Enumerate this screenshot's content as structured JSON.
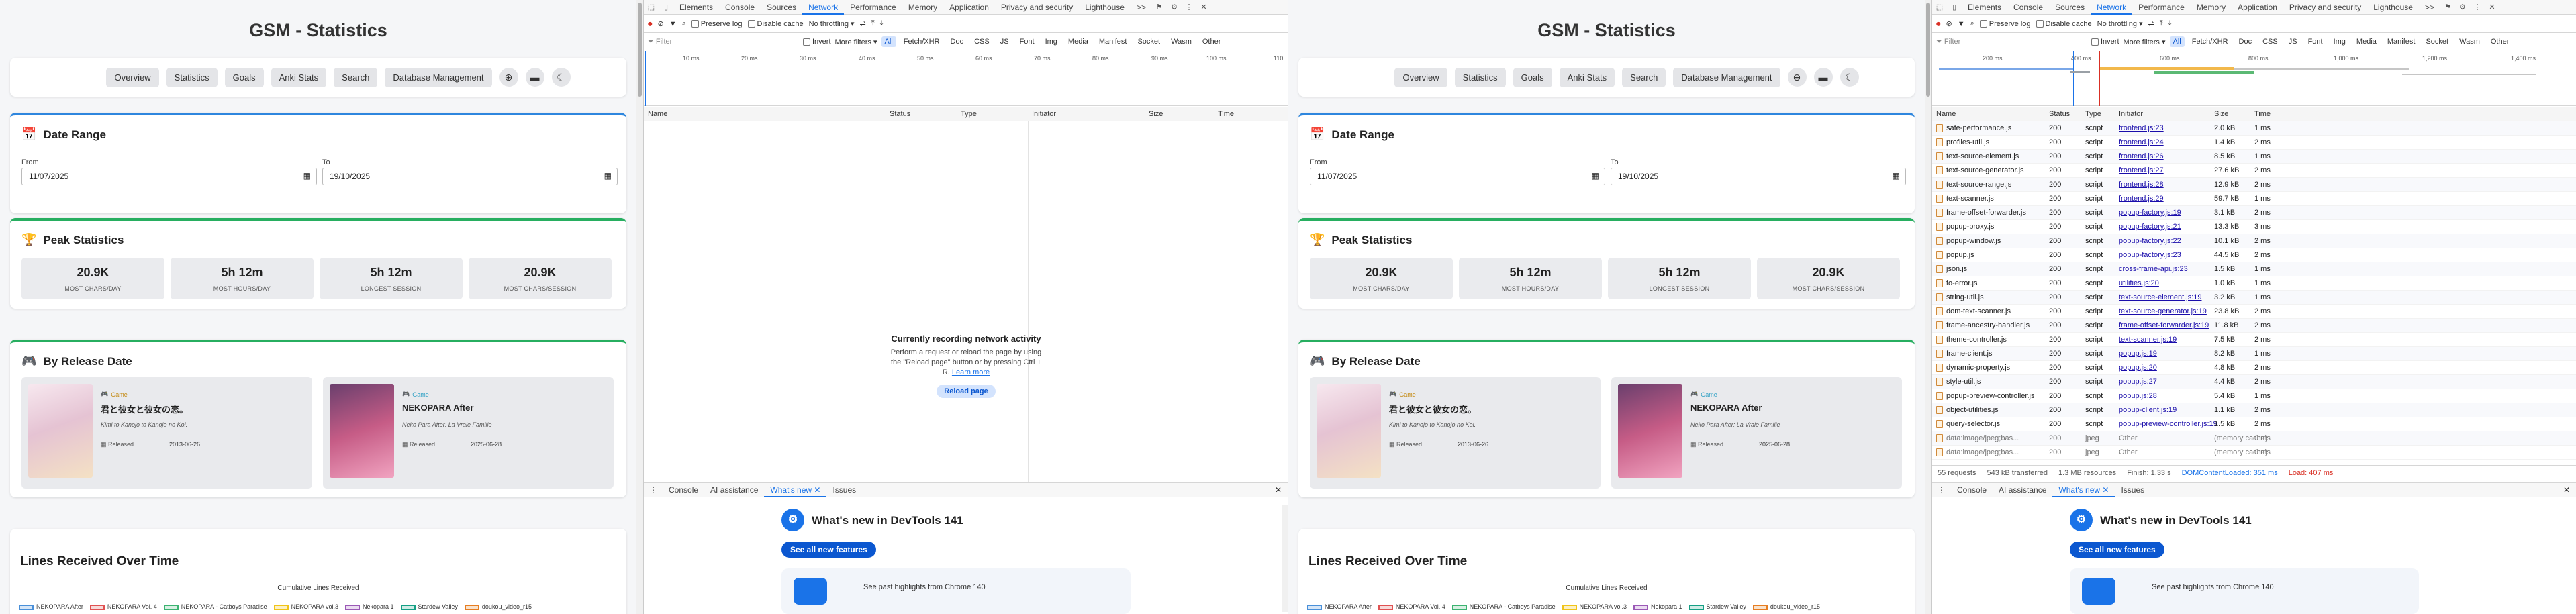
{
  "app": {
    "title": "GSM - Statistics",
    "nav": [
      "Overview",
      "Statistics",
      "Goals",
      "Anki Stats",
      "Search",
      "Database Management"
    ],
    "nav_icons": [
      "circle-plus-icon",
      "folder-icon",
      "moon-icon"
    ]
  },
  "date_range": {
    "title": "Date Range",
    "from_label": "From",
    "from_value": "11/07/2025",
    "to_label": "To",
    "to_value": "19/10/2025"
  },
  "peak": {
    "title": "Peak Statistics",
    "stats": [
      {
        "value": "20.9K",
        "label": "MOST CHARS/DAY"
      },
      {
        "value": "5h 12m",
        "label": "MOST HOURS/DAY"
      },
      {
        "value": "5h 12m",
        "label": "LONGEST SESSION"
      },
      {
        "value": "20.9K",
        "label": "MOST CHARS/SESSION"
      }
    ]
  },
  "release": {
    "title": "By Release Date",
    "games": [
      {
        "type": "Game",
        "title": "君と彼女と彼女の恋。",
        "subtitle": "Kimi to Kanojo to Kanojo no Koi.",
        "released_label": "Released",
        "released": "2013-06-26"
      },
      {
        "type": "Game",
        "title": "NEKOPARA After",
        "subtitle": "Neko Para After: La Vraie Famille",
        "released_label": "Released",
        "released": "2025-06-28"
      }
    ]
  },
  "lines_chart": {
    "title": "Lines Received Over Time",
    "subtitle": "Cumulative Lines Received",
    "legend": [
      {
        "name": "NEKOPARA After",
        "color": "#4a90d9"
      },
      {
        "name": "NEKOPARA Vol. 4",
        "color": "#e05252"
      },
      {
        "name": "NEKOPARA - Catboys Paradise",
        "color": "#3cb371"
      },
      {
        "name": "NEKOPARA vol.3",
        "color": "#f0c419"
      },
      {
        "name": "Nekopara 1",
        "color": "#9b59b6"
      },
      {
        "name": "Stardew Valley",
        "color": "#16a085"
      },
      {
        "name": "doukou_video_r15",
        "color": "#e67e22"
      }
    ]
  },
  "devtools": {
    "tabs": [
      "Elements",
      "Console",
      "Sources",
      "Network",
      "Performance",
      "Memory",
      "Application",
      "Privacy and security",
      "Lighthouse"
    ],
    "active_tab": "Network",
    "more": ">>",
    "toolbar": {
      "preserve_log": "Preserve log",
      "disable_cache": "Disable cache",
      "throttling": "No throttling"
    },
    "filter": {
      "placeholder": "Filter",
      "invert": "Invert",
      "more_filters": "More filters",
      "types": [
        "All",
        "Fetch/XHR",
        "Doc",
        "CSS",
        "JS",
        "Font",
        "Img",
        "Media",
        "Manifest",
        "Socket",
        "Wasm",
        "Other"
      ]
    },
    "columns": [
      "Name",
      "Status",
      "Type",
      "Initiator",
      "Size",
      "Time"
    ],
    "left_ticks": [
      "10 ms",
      "20 ms",
      "30 ms",
      "40 ms",
      "50 ms",
      "60 ms",
      "70 ms",
      "80 ms",
      "90 ms",
      "100 ms",
      "110"
    ],
    "right_ticks": [
      "200 ms",
      "400 ms",
      "600 ms",
      "800 ms",
      "1,000 ms",
      "1,200 ms",
      "1,400 ms"
    ],
    "empty": {
      "heading": "Currently recording network activity",
      "text1": "Perform a request or reload the page by using",
      "text2": "the \"Reload page\" button or by pressing Ctrl +",
      "text3": "R.",
      "learn_more": "Learn more",
      "reload": "Reload page"
    },
    "requests": [
      {
        "name": "safe-performance.js",
        "status": "200",
        "type": "script",
        "initiator": "frontend.js:23",
        "size": "2.0 kB",
        "time": "1 ms"
      },
      {
        "name": "profiles-util.js",
        "status": "200",
        "type": "script",
        "initiator": "frontend.js:24",
        "size": "1.4 kB",
        "time": "2 ms"
      },
      {
        "name": "text-source-element.js",
        "status": "200",
        "type": "script",
        "initiator": "frontend.js:26",
        "size": "8.5 kB",
        "time": "1 ms"
      },
      {
        "name": "text-source-generator.js",
        "status": "200",
        "type": "script",
        "initiator": "frontend.js:27",
        "size": "27.6 kB",
        "time": "2 ms"
      },
      {
        "name": "text-source-range.js",
        "status": "200",
        "type": "script",
        "initiator": "frontend.js:28",
        "size": "12.9 kB",
        "time": "2 ms"
      },
      {
        "name": "text-scanner.js",
        "status": "200",
        "type": "script",
        "initiator": "frontend.js:29",
        "size": "59.7 kB",
        "time": "1 ms"
      },
      {
        "name": "frame-offset-forwarder.js",
        "status": "200",
        "type": "script",
        "initiator": "popup-factory.js:19",
        "size": "3.1 kB",
        "time": "2 ms"
      },
      {
        "name": "popup-proxy.js",
        "status": "200",
        "type": "script",
        "initiator": "popup-factory.js:21",
        "size": "13.3 kB",
        "time": "3 ms"
      },
      {
        "name": "popup-window.js",
        "status": "200",
        "type": "script",
        "initiator": "popup-factory.js:22",
        "size": "10.1 kB",
        "time": "2 ms"
      },
      {
        "name": "popup.js",
        "status": "200",
        "type": "script",
        "initiator": "popup-factory.js:23",
        "size": "44.5 kB",
        "time": "2 ms"
      },
      {
        "name": "json.js",
        "status": "200",
        "type": "script",
        "initiator": "cross-frame-api.js:23",
        "size": "1.5 kB",
        "time": "1 ms"
      },
      {
        "name": "to-error.js",
        "status": "200",
        "type": "script",
        "initiator": "utilities.js:20",
        "size": "1.0 kB",
        "time": "1 ms"
      },
      {
        "name": "string-util.js",
        "status": "200",
        "type": "script",
        "initiator": "text-source-element.js:19",
        "size": "3.2 kB",
        "time": "1 ms"
      },
      {
        "name": "dom-text-scanner.js",
        "status": "200",
        "type": "script",
        "initiator": "text-source-generator.js:19",
        "size": "23.8 kB",
        "time": "2 ms"
      },
      {
        "name": "frame-ancestry-handler.js",
        "status": "200",
        "type": "script",
        "initiator": "frame-offset-forwarder.js:19",
        "size": "11.8 kB",
        "time": "2 ms"
      },
      {
        "name": "theme-controller.js",
        "status": "200",
        "type": "script",
        "initiator": "text-scanner.js:19",
        "size": "7.5 kB",
        "time": "2 ms"
      },
      {
        "name": "frame-client.js",
        "status": "200",
        "type": "script",
        "initiator": "popup.js:19",
        "size": "8.2 kB",
        "time": "1 ms"
      },
      {
        "name": "dynamic-property.js",
        "status": "200",
        "type": "script",
        "initiator": "popup.js:20",
        "size": "4.8 kB",
        "time": "2 ms"
      },
      {
        "name": "style-util.js",
        "status": "200",
        "type": "script",
        "initiator": "popup.js:27",
        "size": "4.4 kB",
        "time": "2 ms"
      },
      {
        "name": "popup-preview-controller.js",
        "status": "200",
        "type": "script",
        "initiator": "popup.js:28",
        "size": "5.4 kB",
        "time": "1 ms"
      },
      {
        "name": "object-utilities.js",
        "status": "200",
        "type": "script",
        "initiator": "popup-client.js:19",
        "size": "1.1 kB",
        "time": "2 ms"
      },
      {
        "name": "query-selector.js",
        "status": "200",
        "type": "script",
        "initiator": "popup-preview-controller.js:19",
        "size": "1.5 kB",
        "time": "2 ms"
      },
      {
        "name": "data:image/jpeg;bas...",
        "status": "200",
        "type": "jpeg",
        "initiator": "Other",
        "size": "(memory cache)",
        "time": "0 ms"
      },
      {
        "name": "data:image/jpeg;bas...",
        "status": "200",
        "type": "jpeg",
        "initiator": "Other",
        "size": "(memory cache)",
        "time": "0 ms"
      }
    ],
    "summary": {
      "requests": "55 requests",
      "transferred": "543 kB transferred",
      "resources": "1.3 MB resources",
      "finish": "Finish: 1.33 s",
      "dcl": "DOMContentLoaded: 351 ms",
      "load": "Load: 407 ms"
    },
    "drawer_tabs": [
      "Console",
      "AI assistance",
      "What's new",
      "Issues"
    ],
    "whats_new": {
      "title": "What's new in DevTools 141",
      "button": "See all new features",
      "card_text": "See past highlights from Chrome 140"
    },
    "colors": {
      "accent": "#1a73e8",
      "dcl": "#1a73e8",
      "load": "#d93025"
    }
  }
}
